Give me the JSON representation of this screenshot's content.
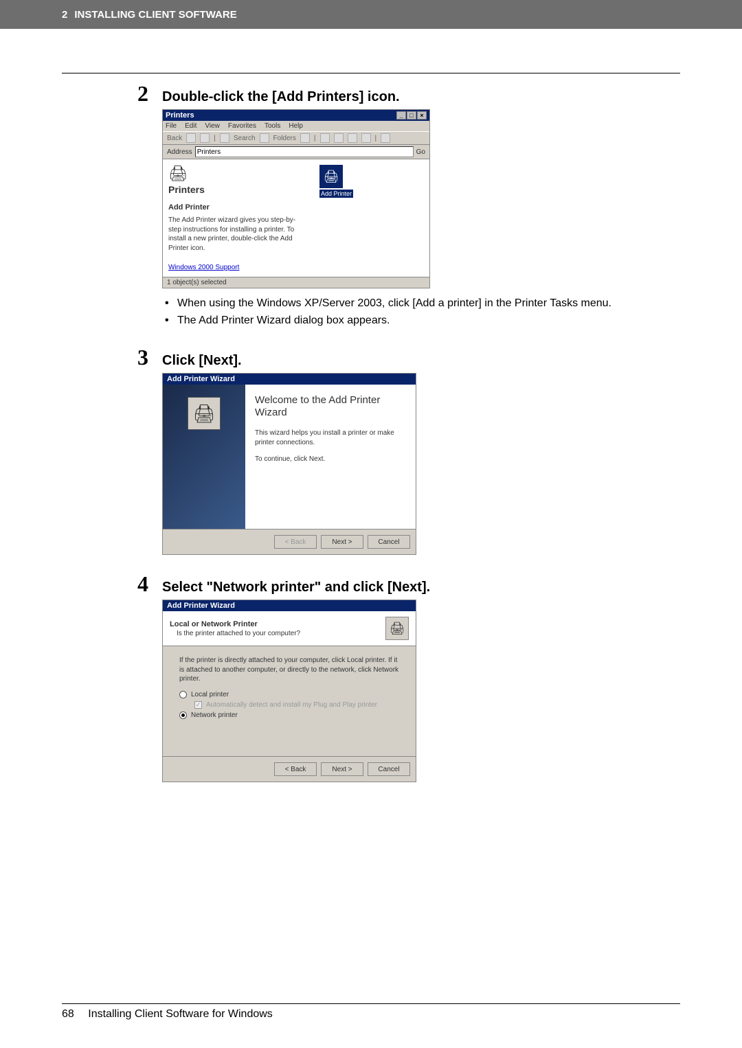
{
  "header": {
    "chapter_num": "2",
    "chapter_title": "INSTALLING CLIENT SOFTWARE"
  },
  "steps": {
    "s2": {
      "num": "2",
      "title": "Double-click the [Add Printers] icon."
    },
    "s3": {
      "num": "3",
      "title": "Click [Next]."
    },
    "s4": {
      "num": "4",
      "title": "Select \"Network printer\" and click [Next]."
    }
  },
  "printers_window": {
    "title": "Printers",
    "menu": [
      "File",
      "Edit",
      "View",
      "Favorites",
      "Tools",
      "Help"
    ],
    "toolbar": {
      "back": "Back",
      "search": "Search",
      "folders": "Folders"
    },
    "address_label": "Address",
    "address_value": "Printers",
    "go_button": "Go",
    "left_panel": {
      "title": "Printers",
      "subtitle": "Add Printer",
      "desc": "The Add Printer wizard gives you step-by-step instructions for installing a printer. To install a new printer, double-click the Add Printer icon.",
      "link": "Windows 2000 Support"
    },
    "icon_label": "Add Printer",
    "status": "1 object(s) selected",
    "win_ctl_min": "_",
    "win_ctl_max": "□",
    "win_ctl_close": "×"
  },
  "bullets_after_s2": [
    "When using the Windows XP/Server 2003, click [Add a printer] in the Printer Tasks menu.",
    "The Add Printer Wizard dialog box appears."
  ],
  "wizard1": {
    "title": "Add Printer Wizard",
    "heading": "Welcome to the Add Printer Wizard",
    "line1": "This wizard helps you install a printer or make printer connections.",
    "line2": "To continue, click Next.",
    "btn_back": "< Back",
    "btn_next": "Next >",
    "btn_cancel": "Cancel"
  },
  "wizard2": {
    "title": "Add Printer Wizard",
    "head_title": "Local or Network Printer",
    "head_sub": "Is the printer attached to your computer?",
    "instr": "If the printer is directly attached to your computer, click Local printer. If it is attached to another computer, or directly to the network, click Network printer.",
    "opt_local": "Local printer",
    "opt_local_auto": "Automatically detect and install my Plug and Play printer",
    "opt_network": "Network printer",
    "btn_back": "< Back",
    "btn_next": "Next >",
    "btn_cancel": "Cancel"
  },
  "footer": {
    "page_num": "68",
    "section": "Installing Client Software for Windows"
  }
}
